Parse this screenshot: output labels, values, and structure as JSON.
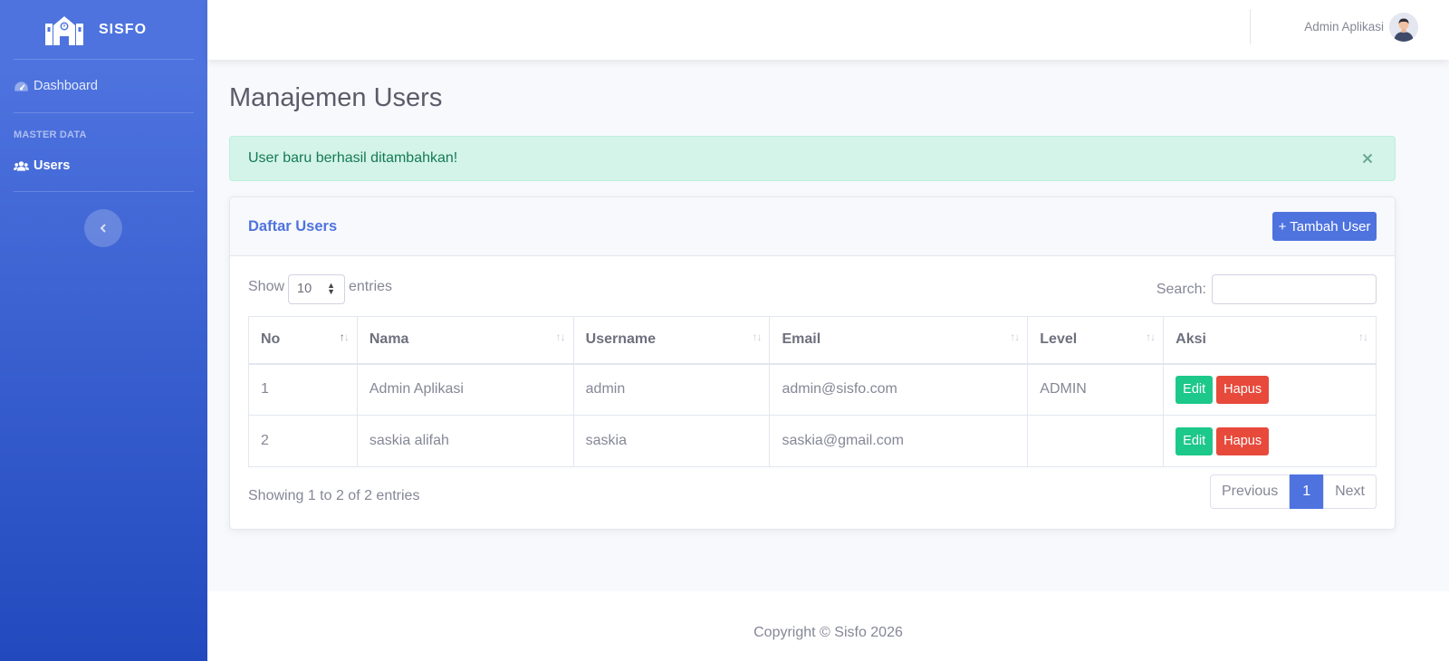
{
  "sidebar": {
    "brand": "SISFO",
    "items": [
      {
        "label": "Dashboard",
        "icon": "tachometer-icon"
      },
      {
        "label": "Users",
        "icon": "users-icon"
      }
    ],
    "heading": "MASTER DATA",
    "toggle_icon": "chevron-left-icon"
  },
  "topbar": {
    "user_name": "Admin Aplikasi"
  },
  "page": {
    "title": "Manajemen Users"
  },
  "alert": {
    "message": "User baru berhasil ditambahkan!"
  },
  "card": {
    "title": "Daftar Users",
    "add_button": "+ Tambah User",
    "show_label": "Show",
    "entries_label": "entries",
    "length_value": "10",
    "search_label": "Search:",
    "search_value": "",
    "columns": [
      "No",
      "Nama",
      "Username",
      "Email",
      "Level",
      "Aksi"
    ],
    "rows": [
      {
        "no": "1",
        "nama": "Admin Aplikasi",
        "username": "admin",
        "email": "admin@sisfo.com",
        "level": "ADMIN",
        "edit": "Edit",
        "hapus": "Hapus"
      },
      {
        "no": "2",
        "nama": "saskia alifah",
        "username": "saskia",
        "email": "saskia@gmail.com",
        "level": "",
        "edit": "Edit",
        "hapus": "Hapus"
      }
    ],
    "info": "Showing 1 to 2 of 2 entries",
    "pagination": {
      "previous": "Previous",
      "current": "1",
      "next": "Next"
    }
  },
  "footer": {
    "copyright": "Copyright © Sisfo 2026"
  },
  "colors": {
    "primary": "#4e73df",
    "success": "#1cc88a",
    "danger": "#e74a3b",
    "alert_bg": "#d4f4e9"
  }
}
